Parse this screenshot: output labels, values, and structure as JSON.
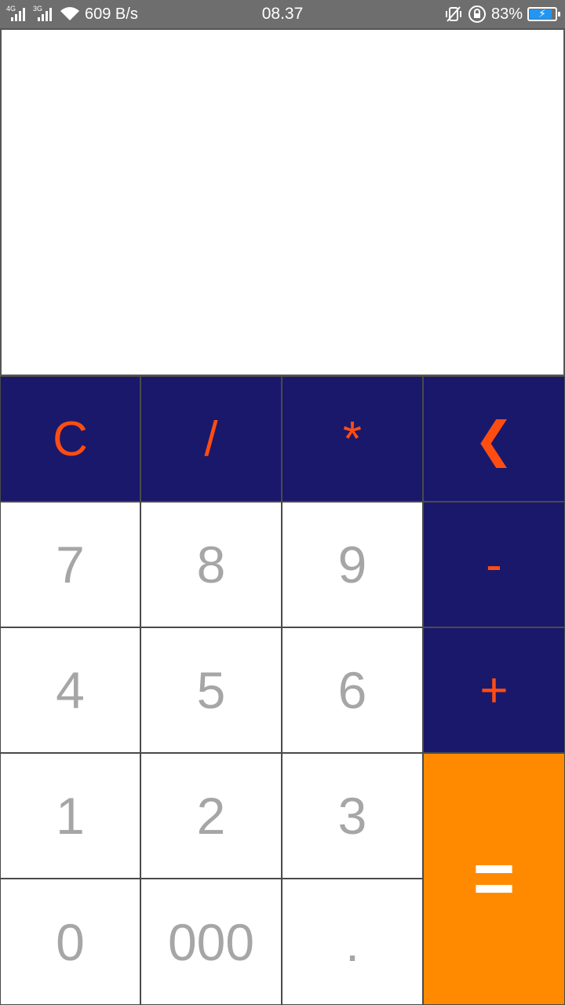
{
  "status_bar": {
    "net1": "4G",
    "net2": "3G",
    "speed": "609 B/s",
    "time": "08.37",
    "battery": "83%",
    "icons": [
      "signal-icon",
      "signal-icon",
      "wifi-icon",
      "vibrate-icon",
      "rotation-lock-icon",
      "battery-charging-icon"
    ]
  },
  "display": {
    "value": ""
  },
  "keys": {
    "clear": "C",
    "divide": "/",
    "multiply": "*",
    "backspace": "❮",
    "seven": "7",
    "eight": "8",
    "nine": "9",
    "minus": "-",
    "four": "4",
    "five": "5",
    "six": "6",
    "plus": "+",
    "one": "1",
    "two": "2",
    "three": "3",
    "equals": "=",
    "zero": "0",
    "triple_zero": "000",
    "decimal": "."
  },
  "colors": {
    "operator_bg": "#1a186b",
    "operator_text": "#ff4d12",
    "equals_bg": "#ff8a00",
    "digit_text": "#a6a6a6"
  }
}
